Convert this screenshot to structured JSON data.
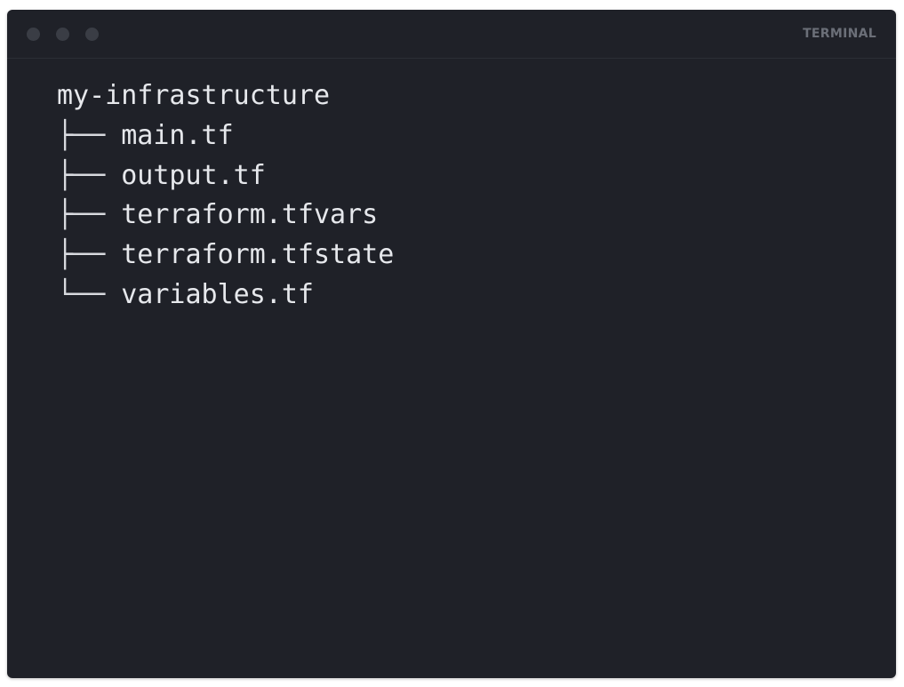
{
  "window": {
    "title": "TERMINAL",
    "colors": {
      "background": "#1f2128",
      "text": "#e6e8ec",
      "title": "#6b6f78",
      "dots": "#3a3d45"
    }
  },
  "tree": {
    "root": "my-infrastructure",
    "entries": [
      {
        "branch": "├──",
        "name": "main.tf"
      },
      {
        "branch": "├──",
        "name": "output.tf"
      },
      {
        "branch": "├──",
        "name": "terraform.tfvars"
      },
      {
        "branch": "├──",
        "name": "terraform.tfstate"
      },
      {
        "branch": "└──",
        "name": "variables.tf"
      }
    ]
  }
}
